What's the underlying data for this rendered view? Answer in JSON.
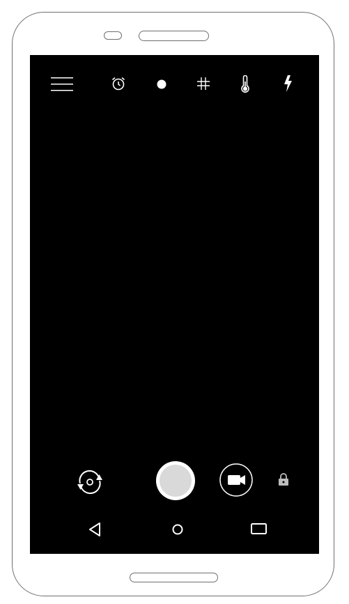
{
  "device": {
    "type": "phone",
    "frame_color": "#6e6e6e"
  },
  "camera_app": {
    "top_toolbar": [
      {
        "name": "menu",
        "icon": "hamburger-menu-icon"
      },
      {
        "name": "timer",
        "icon": "alarm-clock-icon"
      },
      {
        "name": "mode",
        "icon": "dot-icon"
      },
      {
        "name": "grid",
        "icon": "grid-hash-icon"
      },
      {
        "name": "white_balance",
        "icon": "thermometer-icon"
      },
      {
        "name": "flash",
        "icon": "lightning-bolt-icon"
      }
    ],
    "bottom_controls": [
      {
        "name": "switch_camera",
        "icon": "rotate-camera-icon"
      },
      {
        "name": "shutter",
        "icon": "shutter-button"
      },
      {
        "name": "video_mode",
        "icon": "video-camera-icon"
      },
      {
        "name": "lock",
        "icon": "lock-icon"
      }
    ],
    "viewfinder_color": "#000000",
    "shutter_fill": "#d9d9d9"
  },
  "nav_bar": [
    {
      "name": "back",
      "icon": "back-triangle-icon"
    },
    {
      "name": "home",
      "icon": "home-circle-icon"
    },
    {
      "name": "recents",
      "icon": "recents-square-icon"
    }
  ]
}
